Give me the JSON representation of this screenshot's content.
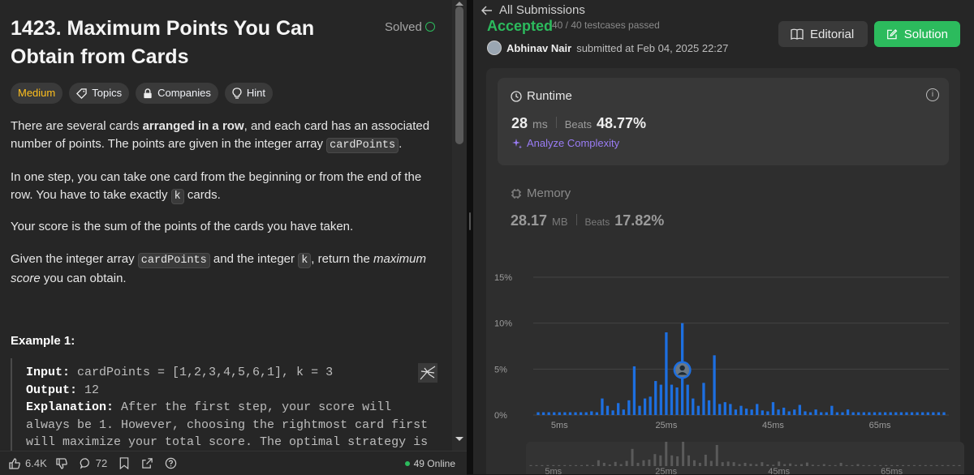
{
  "problem": {
    "title_line1": "1423. Maximum Points You Can",
    "title_line2": "Obtain from Cards",
    "status": "Solved",
    "tags": [
      "Medium",
      "Topics",
      "Companies",
      "Hint"
    ],
    "desc1_a": "There are several cards ",
    "desc1_b": "arranged in a row",
    "desc1_c": ", and each card has an associated number of points. The points are given in the integer array ",
    "desc1_code": "cardPoints",
    "desc1_d": ".",
    "desc2_a": "In one step, you can take one card from the beginning or from the end of the row. You have to take exactly ",
    "desc2_code": "k",
    "desc2_b": " cards.",
    "desc3": "Your score is the sum of the points of the cards you have taken.",
    "desc4_a": "Given the integer array ",
    "desc4_code1": "cardPoints",
    "desc4_b": " and the integer ",
    "desc4_code2": "k",
    "desc4_c": ", return the ",
    "desc4_em": "maximum score",
    "desc4_d": " you can obtain.",
    "example_heading": "Example 1:",
    "ex_input_label": "Input:",
    "ex_input_val": " cardPoints = [1,2,3,4,5,6,1], k = 3",
    "ex_output_label": "Output:",
    "ex_output_val": " 12",
    "ex_expl_label": "Explanation:",
    "ex_expl_1": " After the first step, your score will",
    "ex_expl_2": "always be 1. However, choosing the rightmost card first",
    "ex_expl_3": "will maximize your total score. The optimal strategy is"
  },
  "bottom_bar": {
    "likes": "6.4K",
    "comments": "72",
    "online": "49 Online"
  },
  "submission": {
    "back_label": "All Submissions",
    "status": "Accepted",
    "testcases": "40 / 40 testcases passed",
    "author": "Abhinav Nair",
    "submitted_text": "submitted at Feb 04, 2025 22:27",
    "editorial_label": "Editorial",
    "solution_label": "Solution",
    "runtime_label": "Runtime",
    "runtime_value": "28",
    "runtime_unit": "ms",
    "runtime_beats_label": "Beats",
    "runtime_beats": "48.77%",
    "analyze_label": "Analyze Complexity",
    "memory_label": "Memory",
    "memory_value": "28.17",
    "memory_unit": "MB",
    "memory_beats_label": "Beats",
    "memory_beats": "17.82%"
  },
  "chart_data": {
    "type": "bar",
    "y_ticks": [
      "15%",
      "10%",
      "5%",
      "0%"
    ],
    "x_ticks": [
      "5ms",
      "25ms",
      "45ms",
      "65ms"
    ],
    "ylim": [
      0,
      15
    ],
    "xlim": [
      1,
      77
    ],
    "highlight_ms": 28,
    "bar_color": "#1d6fe0",
    "x": [
      1,
      2,
      3,
      4,
      5,
      6,
      7,
      8,
      9,
      10,
      11,
      12,
      13,
      14,
      15,
      16,
      17,
      18,
      19,
      20,
      21,
      22,
      23,
      24,
      25,
      26,
      27,
      28,
      29,
      30,
      31,
      32,
      33,
      34,
      35,
      36,
      37,
      38,
      39,
      40,
      41,
      42,
      43,
      44,
      45,
      46,
      47,
      48,
      49,
      50,
      51,
      52,
      53,
      54,
      55,
      56,
      57,
      58,
      59,
      60,
      61,
      62,
      63,
      64,
      65,
      66,
      67,
      68,
      69,
      70,
      71,
      72,
      73,
      74,
      75,
      76,
      77
    ],
    "values": [
      0.3,
      0.3,
      0.3,
      0.3,
      0.3,
      0.3,
      0.3,
      0.3,
      0.3,
      0.3,
      0.4,
      0.3,
      1.8,
      1.0,
      0.5,
      1.3,
      0.6,
      1.6,
      5.3,
      1.0,
      1.8,
      2.0,
      3.7,
      3.3,
      9.0,
      3.3,
      3.0,
      10.0,
      3.3,
      1.8,
      1.0,
      3.5,
      1.6,
      6.5,
      1.2,
      1.4,
      1.2,
      0.6,
      1.0,
      0.7,
      0.6,
      1.2,
      0.5,
      0.4,
      1.4,
      0.6,
      0.8,
      0.4,
      0.6,
      1.1,
      0.4,
      0.3,
      0.6,
      0.3,
      0.3,
      1.0,
      0.3,
      0.3,
      0.6,
      0.3,
      0.3,
      0.3,
      0.3,
      0.3,
      0.3,
      0.3,
      0.3,
      0.3,
      0.3,
      0.3,
      0.3,
      0.3,
      0.3,
      0.3,
      0.3,
      0.3,
      0.3
    ]
  }
}
